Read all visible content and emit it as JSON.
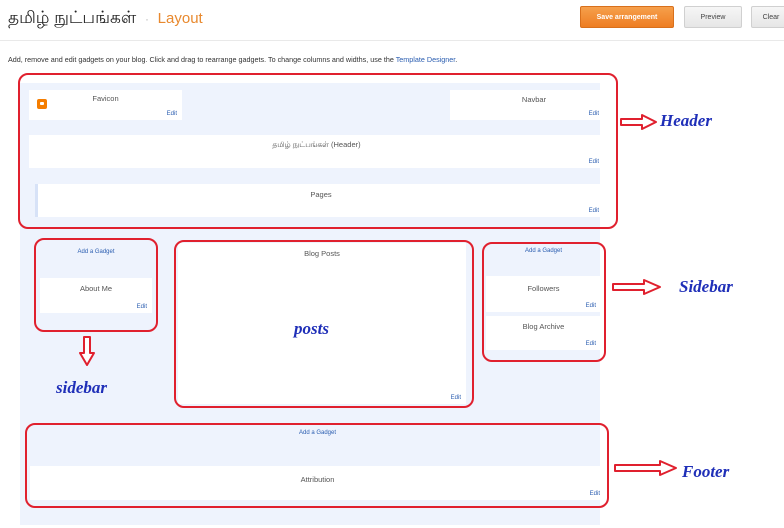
{
  "header": {
    "blog_title": "தமிழ் நுட்பங்கள்",
    "separator": "·",
    "page_name": "Layout",
    "buttons": {
      "save": "Save arrangement",
      "preview": "Preview",
      "clear": "Clear"
    }
  },
  "instructions": {
    "text": "Add, remove and edit gadgets on your blog. Click and drag to rearrange gadgets. To change columns and widths, use the",
    "link": "Template Designer",
    "period": "."
  },
  "layout": {
    "header_section": {
      "favicon": {
        "title": "Favicon",
        "edit": "Edit"
      },
      "navbar": {
        "title": "Navbar",
        "edit": "Edit"
      },
      "blog_header": {
        "title": "தமிழ் நுட்பங்கள் (Header)",
        "edit": "Edit"
      },
      "pages": {
        "title": "Pages",
        "edit": "Edit"
      }
    },
    "left_sidebar": {
      "add_gadget": "Add a Gadget",
      "about_me": {
        "title": "About Me",
        "edit": "Edit"
      }
    },
    "main": {
      "blog_posts": {
        "title": "Blog Posts",
        "edit": "Edit"
      }
    },
    "right_sidebar": {
      "add_gadget": "Add a Gadget",
      "followers": {
        "title": "Followers",
        "edit": "Edit"
      },
      "blog_archive": {
        "title": "Blog Archive",
        "edit": "Edit"
      }
    },
    "footer_section": {
      "add_gadget": "Add a Gadget",
      "attribution": {
        "title": "Attribution",
        "edit": "Edit"
      }
    }
  },
  "annotations": {
    "header": "Header",
    "sidebar_right": "Sidebar",
    "posts": "posts",
    "sidebar_left": "sidebar",
    "footer": "Footer"
  },
  "icons": {
    "favicon": "blogger-icon",
    "arrows": "outline-arrow"
  },
  "colors": {
    "accent_orange": "#ee7d22",
    "link_blue": "#2a5db0",
    "annotation_red": "#e0202e",
    "annotation_blue": "#1f2fb8",
    "canvas": "#eef3fd"
  }
}
